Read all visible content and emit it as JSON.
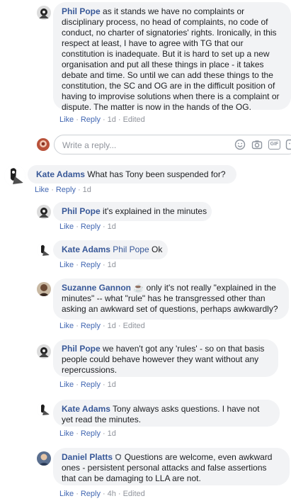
{
  "comments": [
    {
      "id": "phil1",
      "author": "Phil Pope",
      "text": "as it stands we have no complaints or disciplinary process, no head of complaints, no code of conduct, no charter of signatories' rights. Ironically, in this respect at least, I have to agree with TG that our constitution is inadequate. But it is hard to set up a new organisation and put all these things in place - it takes debate and time. So until we can add these things to the constitution, the SC and OG are in the difficult position of having to improvise solutions when there is a complaint or dispute. The matter is now in the hands of the OG.",
      "like": "Like",
      "reply": "Reply",
      "time": "1d",
      "edited": "Edited"
    },
    {
      "id": "kate1",
      "author": "Kate Adams",
      "text": "What has Tony been suspended for?",
      "like": "Like",
      "reply": "Reply",
      "time": "1d"
    },
    {
      "id": "phil2",
      "author": "Phil Pope",
      "text": "it's explained in the minutes",
      "like": "Like",
      "reply": "Reply",
      "time": "1d"
    },
    {
      "id": "kate2",
      "author": "Kate Adams",
      "mention": "Phil Pope",
      "text": "Ok",
      "like": "Like",
      "reply": "Reply",
      "time": "1d"
    },
    {
      "id": "suzanne",
      "author": "Suzanne Gannon",
      "badge": "☕",
      "text": "only it's not really \"explained in the minutes\" -- what \"rule\" has he transgressed other than asking an awkward set of questions, perhaps awkwardly?",
      "like": "Like",
      "reply": "Reply",
      "time": "1d",
      "edited": "Edited"
    },
    {
      "id": "phil3",
      "author": "Phil Pope",
      "text": "we haven't got any 'rules' - so on that basis people could behave however they want without any repercussions.",
      "like": "Like",
      "reply": "Reply",
      "time": "1d"
    },
    {
      "id": "kate3",
      "author": "Kate Adams",
      "text": "Tony always asks questions. I have not yet read the minutes.",
      "like": "Like",
      "reply": "Reply",
      "time": "1d"
    },
    {
      "id": "daniel",
      "author": "Daniel Platts",
      "text": "Questions are welcome, even awkward ones - persistent personal attacks and false assertions that can be damaging to LLA are not.",
      "like": "Like",
      "reply": "Reply",
      "time": "4h",
      "edited": "Edited"
    }
  ],
  "reply_box": {
    "placeholder": "Write a reply...",
    "icons": [
      "emoji-icon",
      "camera-icon",
      "gif-icon",
      "sticker-icon"
    ],
    "gif_label": "GIF"
  },
  "colors": {
    "name": "#385898",
    "link": "#4267b2",
    "meta": "#90949c",
    "bubble": "#f2f3f5"
  }
}
